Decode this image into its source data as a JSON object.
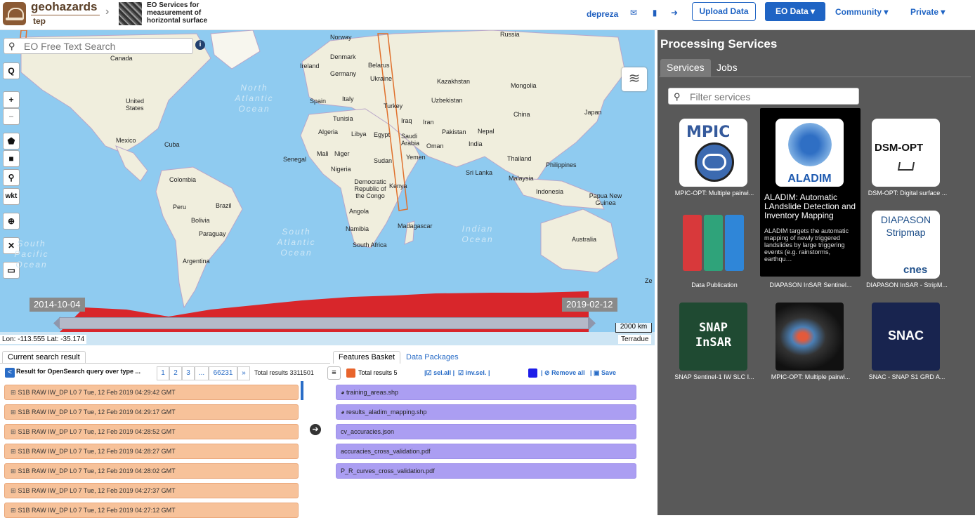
{
  "header": {
    "brand": "geohazards",
    "brand_sub": "tep",
    "project_title": "EO Services for measurement of horizontal surface",
    "username": "depreza",
    "upload_label": "Upload Data",
    "eo_data_label": "EO Data ▾",
    "community_label": "Community ▾",
    "private_label": "Private ▾",
    "accent": "#1f64c4"
  },
  "map": {
    "search_placeholder": "EO Free Text Search",
    "tools": [
      "Q",
      "+",
      "−",
      "⬟",
      "■",
      "⚲",
      "wkt",
      "⊕",
      "✕",
      "▭"
    ],
    "labels": [
      {
        "t": "Norway"
      },
      {
        "t": "Russia"
      },
      {
        "t": "Canada"
      },
      {
        "t": "Ireland"
      },
      {
        "t": "Denmark"
      },
      {
        "t": "Belarus"
      },
      {
        "t": "Germany"
      },
      {
        "t": "Ukraine"
      },
      {
        "t": "Kazakhstan"
      },
      {
        "t": "Mongolia"
      },
      {
        "t": "Spain"
      },
      {
        "t": "Italy"
      },
      {
        "t": "Uzbekistan"
      },
      {
        "t": "United States"
      },
      {
        "t": "Turkey"
      },
      {
        "t": "China"
      },
      {
        "t": "Japan"
      },
      {
        "t": "Tunisia"
      },
      {
        "t": "Iraq"
      },
      {
        "t": "Iran"
      },
      {
        "t": "Algeria"
      },
      {
        "t": "Libya"
      },
      {
        "t": "Egypt"
      },
      {
        "t": "Pakistan"
      },
      {
        "t": "Nepal"
      },
      {
        "t": "Mexico"
      },
      {
        "t": "Saudi Arabia"
      },
      {
        "t": "Oman"
      },
      {
        "t": "India"
      },
      {
        "t": "Cuba"
      },
      {
        "t": "Mali"
      },
      {
        "t": "Niger"
      },
      {
        "t": "Senegal"
      },
      {
        "t": "Sudan"
      },
      {
        "t": "Yemen"
      },
      {
        "t": "Thailand"
      },
      {
        "t": "Philippines"
      },
      {
        "t": "Nigeria"
      },
      {
        "t": "Sri Lanka"
      },
      {
        "t": "Malaysia"
      },
      {
        "t": "Colombia"
      },
      {
        "t": "Democratic Republic of the Congo"
      },
      {
        "t": "Kenya"
      },
      {
        "t": "Indonesia"
      },
      {
        "t": "Papua New Guinea"
      },
      {
        "t": "Peru"
      },
      {
        "t": "Brazil"
      },
      {
        "t": "Angola"
      },
      {
        "t": "Bolivia"
      },
      {
        "t": "Madagascar"
      },
      {
        "t": "Paraguay"
      },
      {
        "t": "Namibia"
      },
      {
        "t": "Australia"
      },
      {
        "t": "South Africa"
      },
      {
        "t": "Argentina"
      },
      {
        "t": "Ze"
      }
    ],
    "oceans": [
      "North Atlantic Ocean",
      "South Atlantic Ocean",
      "Indian Ocean",
      "South Pacific Ocean"
    ],
    "date_start": "2014-10-04",
    "date_end": "2019-02-12",
    "scale": "2000 km",
    "coords": "Lon: -113.555 Lat: -35.174",
    "attribution": "Terradue"
  },
  "results": {
    "tab_label": "Current search result",
    "header_text": "Result for OpenSearch query over type ...",
    "pages": [
      "1",
      "2",
      "3",
      "...",
      "66231",
      "»"
    ],
    "total": "Total results  3311501",
    "rows": [
      "S1B RAW IW_DP L0 7 Tue, 12 Feb 2019 04:29:42 GMT",
      "S1B RAW IW_DP L0 7 Tue, 12 Feb 2019 04:29:17 GMT",
      "S1B RAW IW_DP L0 7 Tue, 12 Feb 2019 04:28:52 GMT",
      "S1B RAW IW_DP L0 7 Tue, 12 Feb 2019 04:28:27 GMT",
      "S1B RAW IW_DP L0 7 Tue, 12 Feb 2019 04:28:02 GMT",
      "S1B RAW IW_DP L0 7 Tue, 12 Feb 2019 04:27:37 GMT",
      "S1B RAW IW_DP L0 7 Tue, 12 Feb 2019 04:27:12 GMT"
    ]
  },
  "basket": {
    "tab_features": "Features Basket",
    "tab_packages": "Data Packages",
    "total": "Total results  5",
    "sel_all": "sel.all",
    "inv_sel": "inv.sel.",
    "remove_all": "Remove all",
    "save": "Save",
    "items": [
      "training_areas.shp",
      "results_aladim_mapping.shp",
      "cv_accuracies.json",
      "accuracies_cross_validation.pdf",
      "P_R_curves_cross_validation.pdf"
    ]
  },
  "services": {
    "title": "Processing Services",
    "tab_services": "Services",
    "tab_jobs": "Jobs",
    "filter_placeholder": "Filter services",
    "tiles": [
      {
        "label": "MPIC-OPT: Multiple pairwi...",
        "logo": "MPIC"
      },
      {
        "label": "",
        "logo": "ALADIM"
      },
      {
        "label": "DSM-OPT: Digital surface ...",
        "logo": "DSM-OPT"
      },
      {
        "label": "Data Publication",
        "logo": ""
      },
      {
        "label": "DIAPASON InSAR Sentinel...",
        "logo": ""
      },
      {
        "label": "DIAPASON InSAR - StripM...",
        "logo": "DIAPASON Stripmap"
      },
      {
        "label": "SNAP Sentinel-1 IW SLC I...",
        "logo": "SNAP InSAR"
      },
      {
        "label": "MPIC-OPT: Multiple pairwi...",
        "logo": ""
      },
      {
        "label": "SNAC - SNAP S1 GRD A...",
        "logo": "SNAC"
      }
    ],
    "tooltip_title": "ALADIM: Automatic LAndslide Detection and Inventory Mapping",
    "tooltip_desc": "ALADIM targets the automatic mapping of newly triggered landslides by large triggering events (e.g. rainstorms, earthqu…"
  }
}
